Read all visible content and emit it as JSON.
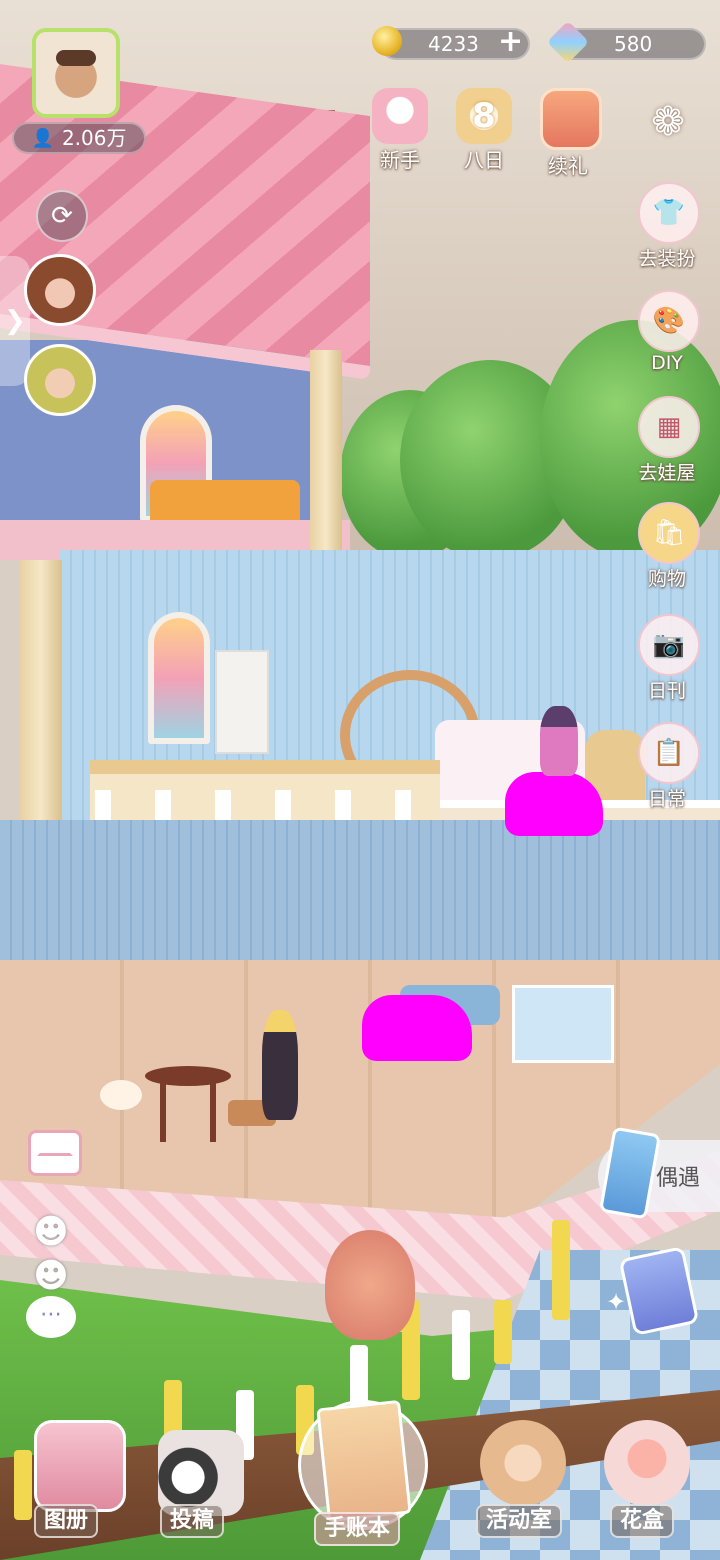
{
  "player": {
    "followers": "2.06万"
  },
  "currency": {
    "coins": "4233",
    "coin_add": "+",
    "gems": "580"
  },
  "events": [
    {
      "label": "新手",
      "icon": "bunny-cake-icon"
    },
    {
      "label": "八日",
      "icon": "eight-day-icon"
    },
    {
      "label": "续礼",
      "icon": "tv-gift-icon"
    }
  ],
  "side_menu": [
    {
      "label": "去装扮",
      "icon": "shirt-icon"
    },
    {
      "label": "DIY",
      "icon": "palette-icon"
    },
    {
      "label": "去娃屋",
      "icon": "cabinet-icon"
    },
    {
      "label": "购物",
      "icon": "shopping-bag-icon"
    },
    {
      "label": "日刊",
      "icon": "camera-icon"
    },
    {
      "label": "日常",
      "icon": "checklist-icon"
    }
  ],
  "encounter": {
    "label": "偶遇"
  },
  "bottom_nav": [
    {
      "label": "图册",
      "icon": "album-icon"
    },
    {
      "label": "投稿",
      "icon": "film-reel-icon"
    },
    {
      "label": "手账本",
      "icon": "journal-icon"
    },
    {
      "label": "活动室",
      "icon": "teddy-bear-icon"
    },
    {
      "label": "花盒",
      "icon": "flower-box-icon"
    }
  ],
  "colors": {
    "hud_text": "#ffffff",
    "accent_pink": "#c2566b",
    "avatar_border": "#b7e16a",
    "gold": "#e8b72c"
  }
}
